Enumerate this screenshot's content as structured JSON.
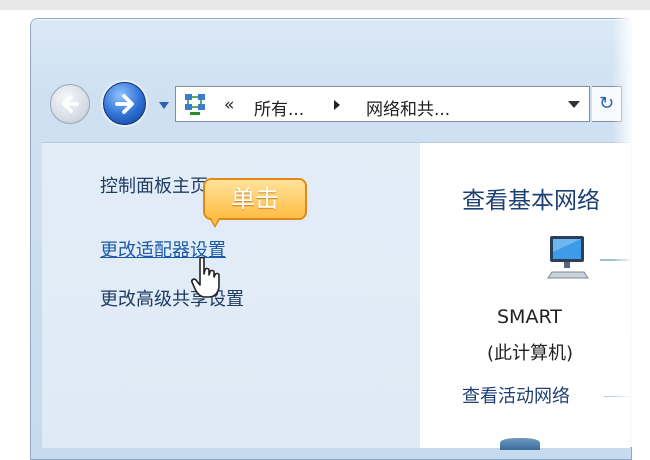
{
  "address_bar": {
    "separator": "«",
    "crumbs": [
      "所有...",
      "网络和共..."
    ]
  },
  "left_pane": {
    "home": "控制面板主页",
    "change_adapter": "更改适配器设置",
    "change_advanced": "更改高级共享设置"
  },
  "callout": {
    "text": "单击"
  },
  "main": {
    "title": "查看基本网络",
    "computer_name": "SMART",
    "computer_sub": "(此计算机)",
    "active_networks": "查看活动网络"
  },
  "icons": {
    "back": "back-arrow-icon",
    "forward": "forward-arrow-icon",
    "network": "network-icon",
    "computer": "computer-icon",
    "refresh": "refresh-icon",
    "cursor": "hand-cursor-icon"
  },
  "colors": {
    "link": "#1a5aa8",
    "title": "#1e3f73",
    "callout": "#ffbd45"
  }
}
